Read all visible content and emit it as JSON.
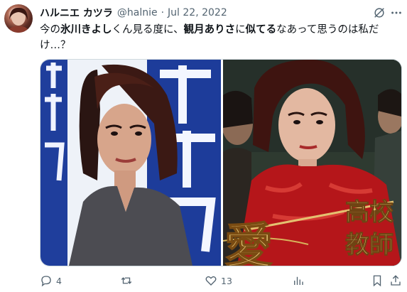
{
  "tweet": {
    "author_name": "ハルニエ カツラ",
    "handle": "@halnie",
    "separator": "·",
    "date": "Jul 22, 2022",
    "text": {
      "p1": "今の",
      "bold1": "氷川きよし",
      "p2": "くん見る度に、",
      "bold2": "観月ありさ",
      "p3": "に",
      "bold3": "似てる",
      "p4": "なあって思うのは私だけ…？"
    },
    "poster_text": {
      "left_glyph": "愛",
      "title_1": "高校",
      "title_2": "教師"
    },
    "actions": {
      "reply_count": "4",
      "repost_count": "",
      "like_count": "13"
    }
  },
  "icons": {
    "grok": "grok-icon",
    "more": "more-icon",
    "reply": "reply-icon",
    "repost": "repost-icon",
    "like": "heart-icon",
    "views": "views-icon",
    "bookmark": "bookmark-icon",
    "share": "share-icon"
  },
  "colors": {
    "text": "#0f1419",
    "secondary": "#536471",
    "border": "#cfd9de",
    "poster_red": "#b5161a",
    "poster_gold": "#d8b35a"
  }
}
